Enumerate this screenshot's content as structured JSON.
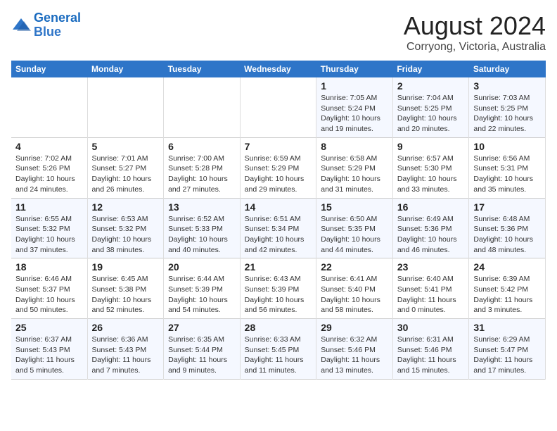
{
  "logo": {
    "line1": "General",
    "line2": "Blue"
  },
  "title": "August 2024",
  "subtitle": "Corryong, Victoria, Australia",
  "days_of_week": [
    "Sunday",
    "Monday",
    "Tuesday",
    "Wednesday",
    "Thursday",
    "Friday",
    "Saturday"
  ],
  "weeks": [
    [
      {
        "day": "",
        "info": ""
      },
      {
        "day": "",
        "info": ""
      },
      {
        "day": "",
        "info": ""
      },
      {
        "day": "",
        "info": ""
      },
      {
        "day": "1",
        "info": "Sunrise: 7:05 AM\nSunset: 5:24 PM\nDaylight: 10 hours\nand 19 minutes."
      },
      {
        "day": "2",
        "info": "Sunrise: 7:04 AM\nSunset: 5:25 PM\nDaylight: 10 hours\nand 20 minutes."
      },
      {
        "day": "3",
        "info": "Sunrise: 7:03 AM\nSunset: 5:25 PM\nDaylight: 10 hours\nand 22 minutes."
      }
    ],
    [
      {
        "day": "4",
        "info": "Sunrise: 7:02 AM\nSunset: 5:26 PM\nDaylight: 10 hours\nand 24 minutes."
      },
      {
        "day": "5",
        "info": "Sunrise: 7:01 AM\nSunset: 5:27 PM\nDaylight: 10 hours\nand 26 minutes."
      },
      {
        "day": "6",
        "info": "Sunrise: 7:00 AM\nSunset: 5:28 PM\nDaylight: 10 hours\nand 27 minutes."
      },
      {
        "day": "7",
        "info": "Sunrise: 6:59 AM\nSunset: 5:29 PM\nDaylight: 10 hours\nand 29 minutes."
      },
      {
        "day": "8",
        "info": "Sunrise: 6:58 AM\nSunset: 5:29 PM\nDaylight: 10 hours\nand 31 minutes."
      },
      {
        "day": "9",
        "info": "Sunrise: 6:57 AM\nSunset: 5:30 PM\nDaylight: 10 hours\nand 33 minutes."
      },
      {
        "day": "10",
        "info": "Sunrise: 6:56 AM\nSunset: 5:31 PM\nDaylight: 10 hours\nand 35 minutes."
      }
    ],
    [
      {
        "day": "11",
        "info": "Sunrise: 6:55 AM\nSunset: 5:32 PM\nDaylight: 10 hours\nand 37 minutes."
      },
      {
        "day": "12",
        "info": "Sunrise: 6:53 AM\nSunset: 5:32 PM\nDaylight: 10 hours\nand 38 minutes."
      },
      {
        "day": "13",
        "info": "Sunrise: 6:52 AM\nSunset: 5:33 PM\nDaylight: 10 hours\nand 40 minutes."
      },
      {
        "day": "14",
        "info": "Sunrise: 6:51 AM\nSunset: 5:34 PM\nDaylight: 10 hours\nand 42 minutes."
      },
      {
        "day": "15",
        "info": "Sunrise: 6:50 AM\nSunset: 5:35 PM\nDaylight: 10 hours\nand 44 minutes."
      },
      {
        "day": "16",
        "info": "Sunrise: 6:49 AM\nSunset: 5:36 PM\nDaylight: 10 hours\nand 46 minutes."
      },
      {
        "day": "17",
        "info": "Sunrise: 6:48 AM\nSunset: 5:36 PM\nDaylight: 10 hours\nand 48 minutes."
      }
    ],
    [
      {
        "day": "18",
        "info": "Sunrise: 6:46 AM\nSunset: 5:37 PM\nDaylight: 10 hours\nand 50 minutes."
      },
      {
        "day": "19",
        "info": "Sunrise: 6:45 AM\nSunset: 5:38 PM\nDaylight: 10 hours\nand 52 minutes."
      },
      {
        "day": "20",
        "info": "Sunrise: 6:44 AM\nSunset: 5:39 PM\nDaylight: 10 hours\nand 54 minutes."
      },
      {
        "day": "21",
        "info": "Sunrise: 6:43 AM\nSunset: 5:39 PM\nDaylight: 10 hours\nand 56 minutes."
      },
      {
        "day": "22",
        "info": "Sunrise: 6:41 AM\nSunset: 5:40 PM\nDaylight: 10 hours\nand 58 minutes."
      },
      {
        "day": "23",
        "info": "Sunrise: 6:40 AM\nSunset: 5:41 PM\nDaylight: 11 hours\nand 0 minutes."
      },
      {
        "day": "24",
        "info": "Sunrise: 6:39 AM\nSunset: 5:42 PM\nDaylight: 11 hours\nand 3 minutes."
      }
    ],
    [
      {
        "day": "25",
        "info": "Sunrise: 6:37 AM\nSunset: 5:43 PM\nDaylight: 11 hours\nand 5 minutes."
      },
      {
        "day": "26",
        "info": "Sunrise: 6:36 AM\nSunset: 5:43 PM\nDaylight: 11 hours\nand 7 minutes."
      },
      {
        "day": "27",
        "info": "Sunrise: 6:35 AM\nSunset: 5:44 PM\nDaylight: 11 hours\nand 9 minutes."
      },
      {
        "day": "28",
        "info": "Sunrise: 6:33 AM\nSunset: 5:45 PM\nDaylight: 11 hours\nand 11 minutes."
      },
      {
        "day": "29",
        "info": "Sunrise: 6:32 AM\nSunset: 5:46 PM\nDaylight: 11 hours\nand 13 minutes."
      },
      {
        "day": "30",
        "info": "Sunrise: 6:31 AM\nSunset: 5:46 PM\nDaylight: 11 hours\nand 15 minutes."
      },
      {
        "day": "31",
        "info": "Sunrise: 6:29 AM\nSunset: 5:47 PM\nDaylight: 11 hours\nand 17 minutes."
      }
    ]
  ]
}
